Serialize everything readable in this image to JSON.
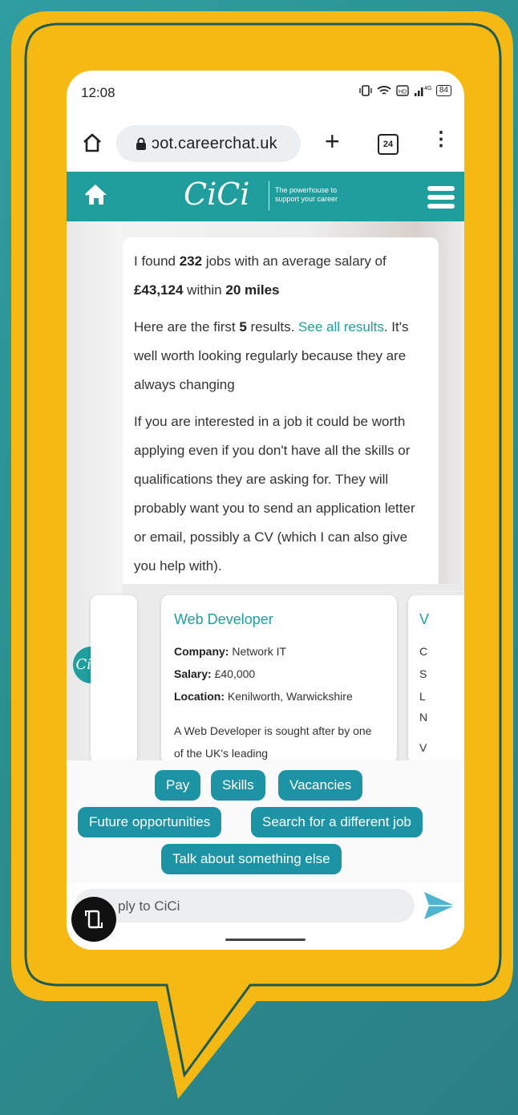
{
  "status_bar": {
    "time": "12:08",
    "battery": "84"
  },
  "browser": {
    "url": "ɔot.careerchat.uk",
    "tab_count": "24"
  },
  "app_header": {
    "logo": "CiCi",
    "tagline_line1": "The powerhouse to",
    "tagline_line2": "support your career"
  },
  "message": {
    "p1_a": "I found ",
    "p1_count": "232",
    "p1_b": " jobs with an average salary of ",
    "p1_salary": "£43,124",
    "p1_c": " within ",
    "p1_radius": "20 miles",
    "p2_a": "Here are the first ",
    "p2_count": "5",
    "p2_b": " results. ",
    "p2_link": "See all results",
    "p2_c": ".",
    "p2_d": "It's well worth looking regularly because they are always changing",
    "p3": "If you are interested in a job it could be worth applying even if you don't have all the skills or qualifications they are asking for. They will probably want you to send an application letter or email, possibly a CV (which I can also give you help with)."
  },
  "avatar_label": "CiCi",
  "job_card": {
    "title": "Web Developer",
    "company_label": "Company:",
    "company": "Network IT",
    "salary_label": "Salary:",
    "salary": "£40,000",
    "location_label": "Location:",
    "location": "Kenilworth, Warwickshire",
    "description": "A Web Developer is sought after by one of the UK's leading"
  },
  "next_card_glyphs": {
    "title": "V",
    "r1": "C",
    "r2": "S",
    "r3": "L",
    "r4": "N",
    "r5": "V"
  },
  "quick_replies": [
    "Pay",
    "Skills",
    "Vacancies",
    "Future opportunities",
    "Search for a different job",
    "Talk about something else"
  ],
  "input": {
    "placeholder": "Reply to CiCi",
    "visible_text": "ply to CiCi"
  },
  "colors": {
    "teal": "#1f9e9d",
    "chip": "#1d93a6",
    "bubble_yellow": "#f6b914",
    "background": "#2b8f8f"
  }
}
